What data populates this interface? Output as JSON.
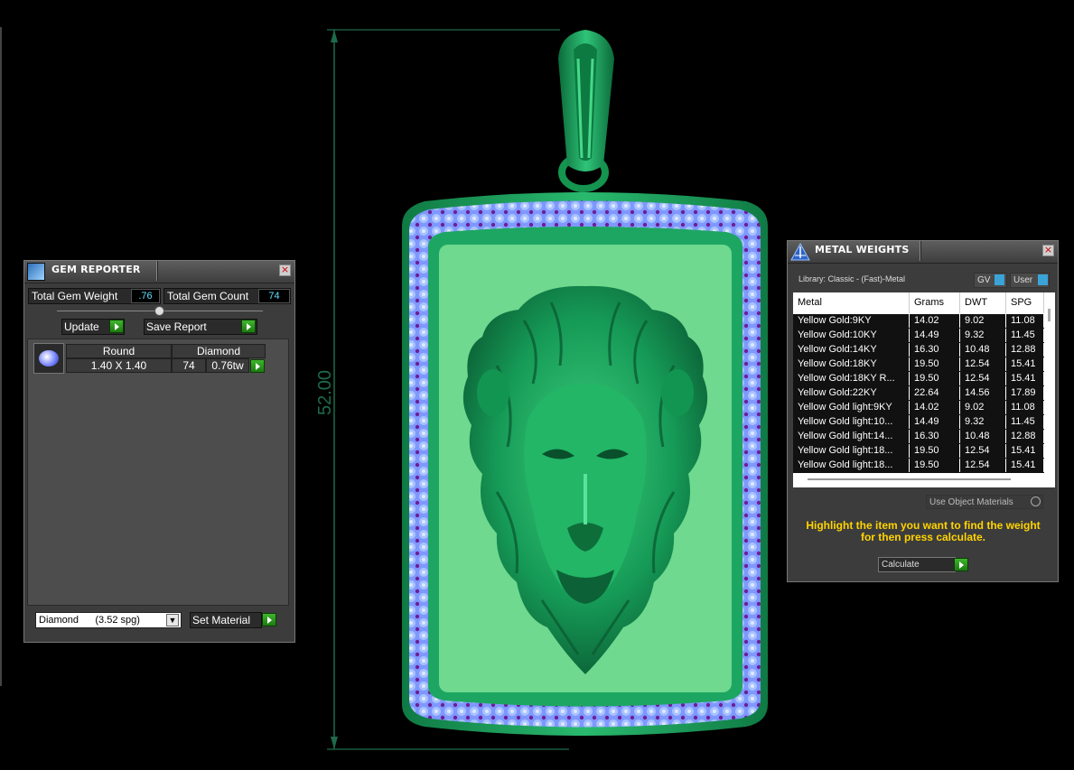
{
  "dimension": {
    "label": "52.00"
  },
  "gem_reporter": {
    "title": "GEM REPORTER",
    "close": "×",
    "total_gem_weight_label": "Total Gem Weight",
    "total_gem_weight_value": ".76",
    "total_gem_count_label": "Total Gem Count",
    "total_gem_count_value": "74",
    "update_label": "Update",
    "save_report_label": "Save Report",
    "grid": {
      "shape": "Round",
      "material": "Diamond",
      "size": "1.40 X 1.40",
      "count": "74",
      "weight": "0.76tw"
    },
    "material_select": "Diamond      (3.52 spg)",
    "set_material_label": "Set Material"
  },
  "metal_weights": {
    "title": "METAL WEIGHTS",
    "close": "×",
    "library": "Library: Classic - (Fast)-Metal",
    "gv_label": "GV",
    "user_label": "User",
    "columns": [
      "Metal",
      "Grams",
      "DWT",
      "SPG"
    ],
    "rows": [
      {
        "metal": "Yellow Gold:9KY",
        "grams": "14.02",
        "dwt": "9.02",
        "spg": "11.08"
      },
      {
        "metal": "Yellow Gold:10KY",
        "grams": "14.49",
        "dwt": "9.32",
        "spg": "11.45"
      },
      {
        "metal": "Yellow Gold:14KY",
        "grams": "16.30",
        "dwt": "10.48",
        "spg": "12.88"
      },
      {
        "metal": "Yellow Gold:18KY",
        "grams": "19.50",
        "dwt": "12.54",
        "spg": "15.41"
      },
      {
        "metal": "Yellow Gold:18KY R...",
        "grams": "19.50",
        "dwt": "12.54",
        "spg": "15.41"
      },
      {
        "metal": "Yellow Gold:22KY",
        "grams": "22.64",
        "dwt": "14.56",
        "spg": "17.89"
      },
      {
        "metal": "Yellow Gold light:9KY",
        "grams": "14.02",
        "dwt": "9.02",
        "spg": "11.08"
      },
      {
        "metal": "Yellow Gold light:10...",
        "grams": "14.49",
        "dwt": "9.32",
        "spg": "11.45"
      },
      {
        "metal": "Yellow Gold light:14...",
        "grams": "16.30",
        "dwt": "10.48",
        "spg": "12.88"
      },
      {
        "metal": "Yellow Gold light:18...",
        "grams": "19.50",
        "dwt": "12.54",
        "spg": "15.41"
      },
      {
        "metal": "Yellow Gold light:18...",
        "grams": "19.50",
        "dwt": "12.54",
        "spg": "15.41"
      }
    ],
    "use_object_materials": "Use Object Materials",
    "hint": "Highlight the item you want to find the weight for then press calculate.",
    "calculate_label": "Calculate"
  },
  "colors": {
    "model_green": "#1f9e5a",
    "plate_green": "#6fd98f",
    "gem_blue": "#8aa8ff",
    "prong_purple": "#7a2aa0",
    "hint_yellow": "#ffd400",
    "dimension_green": "#1d6b4b"
  }
}
